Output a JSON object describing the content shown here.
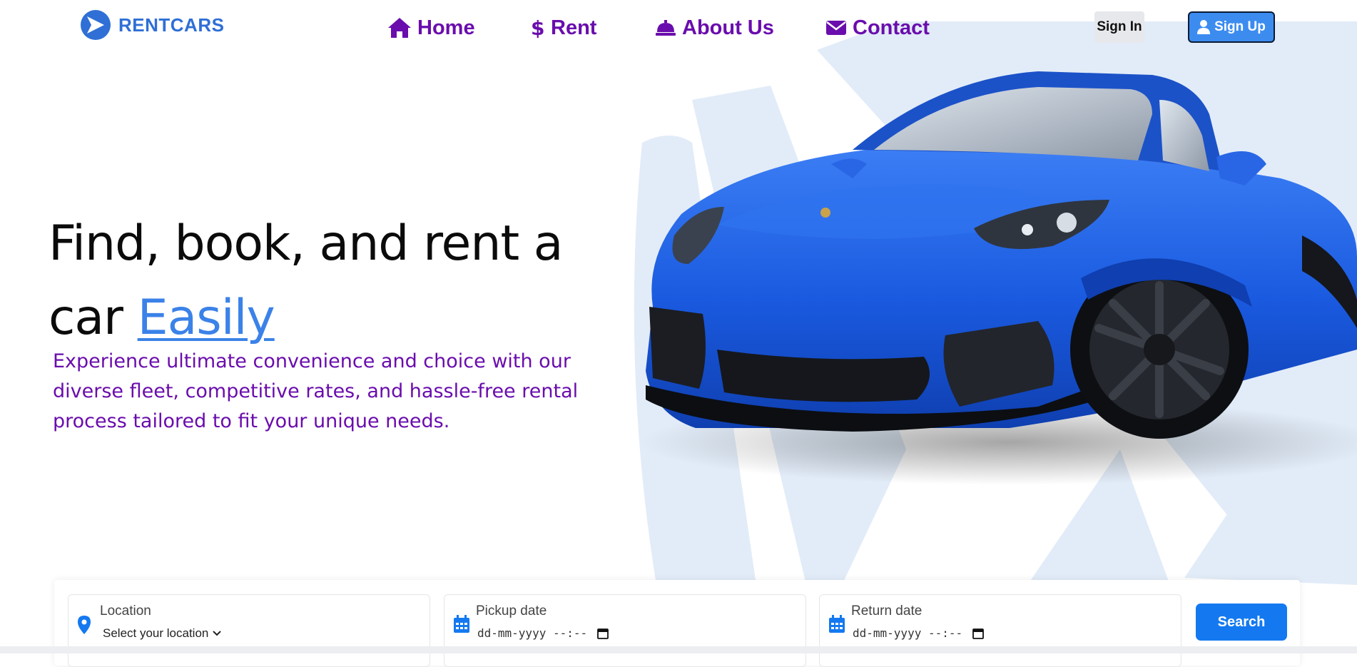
{
  "brand": {
    "name": "RENTCARS",
    "color": "#2f6fd6"
  },
  "nav": {
    "items": [
      {
        "label": "Home",
        "icon": "home-icon"
      },
      {
        "label": "Rent",
        "icon": "dollar-icon"
      },
      {
        "label": "About Us",
        "icon": "bell-icon"
      },
      {
        "label": "Contact",
        "icon": "envelope-icon"
      }
    ],
    "color": "#6a0dad"
  },
  "auth": {
    "signin_label": "Sign In",
    "signup_label": "Sign Up",
    "signup_icon": "user-icon"
  },
  "hero": {
    "headline_prefix": "Find, book, and rent a car ",
    "headline_accent": "Easily",
    "subtitle": "Experience ultimate convenience and choice with our diverse fleet, competitive rates, and hassle-free rental process tailored to fit your unique needs.",
    "accent_color": "#3b82e8",
    "image": "blue-sports-car"
  },
  "search": {
    "location": {
      "label": "Location",
      "value": "Select your location",
      "icon": "map-pin-icon"
    },
    "pickup": {
      "label": "Pickup date",
      "value": "dd-mm-yyyy --:--",
      "icon": "calendar-icon"
    },
    "return": {
      "label": "Return date",
      "value": "dd-mm-yyyy --:--",
      "icon": "calendar-icon"
    },
    "button_label": "Search",
    "button_color": "#1479f0"
  }
}
